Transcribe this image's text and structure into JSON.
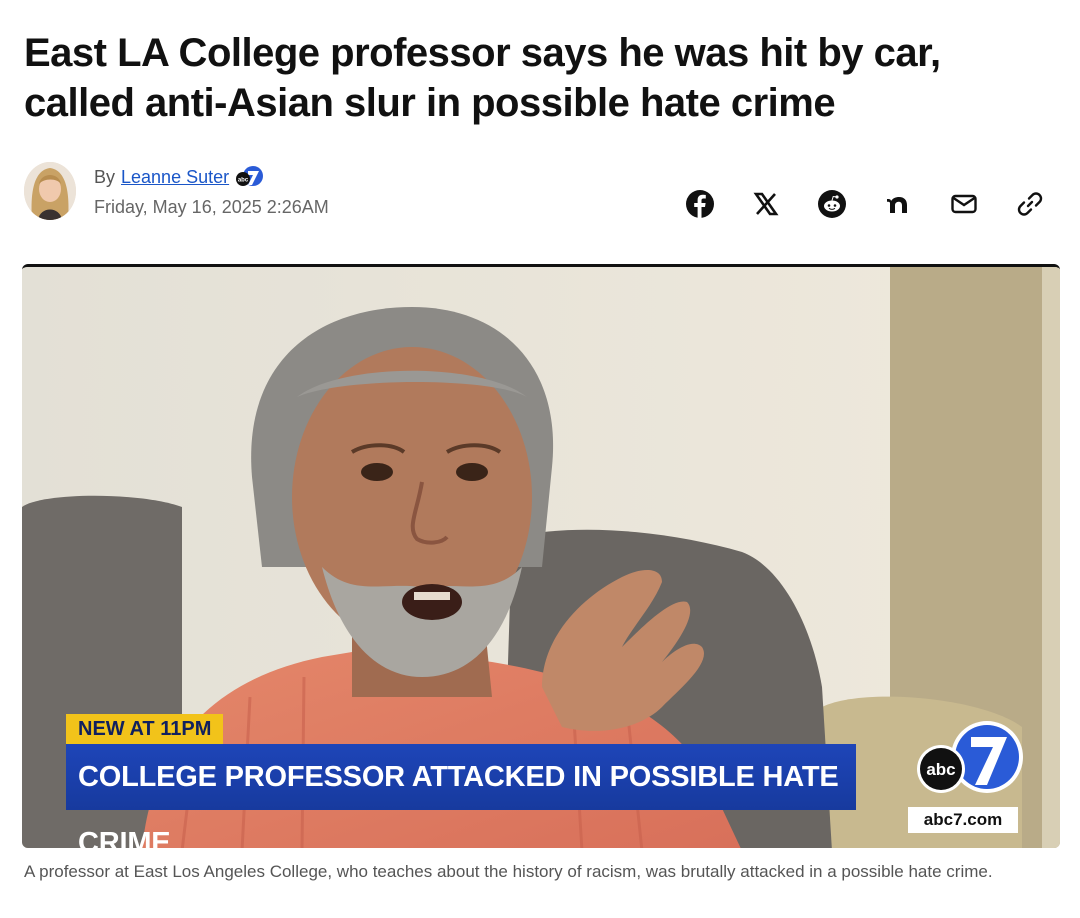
{
  "article": {
    "headline": "East LA College professor says he was hit by car, called anti-Asian slur in possible hate crime",
    "byline_prefix": "By",
    "author": "Leanne Suter",
    "author_badge": "abc",
    "date": "Friday, May 16, 2025 2:26AM"
  },
  "share": {
    "icons": [
      "facebook-icon",
      "x-icon",
      "reddit-icon",
      "nextdoor-icon",
      "email-icon",
      "link-icon"
    ]
  },
  "media": {
    "tag": "NEW AT 11PM",
    "lower_third": "COLLEGE PROFESSOR ATTACKED IN POSSIBLE HATE CRIME",
    "logo_abc": "abc",
    "logo_seven": "7",
    "logo_url": "abc7.com"
  },
  "caption": "A professor at East Los Angeles College, who teaches about the history of racism, was brutally attacked in a possible hate crime.",
  "colors": {
    "author_link": "#1a56c8",
    "lower_third_bg": "#1e45b8",
    "tag_bg": "#f2c31a"
  }
}
